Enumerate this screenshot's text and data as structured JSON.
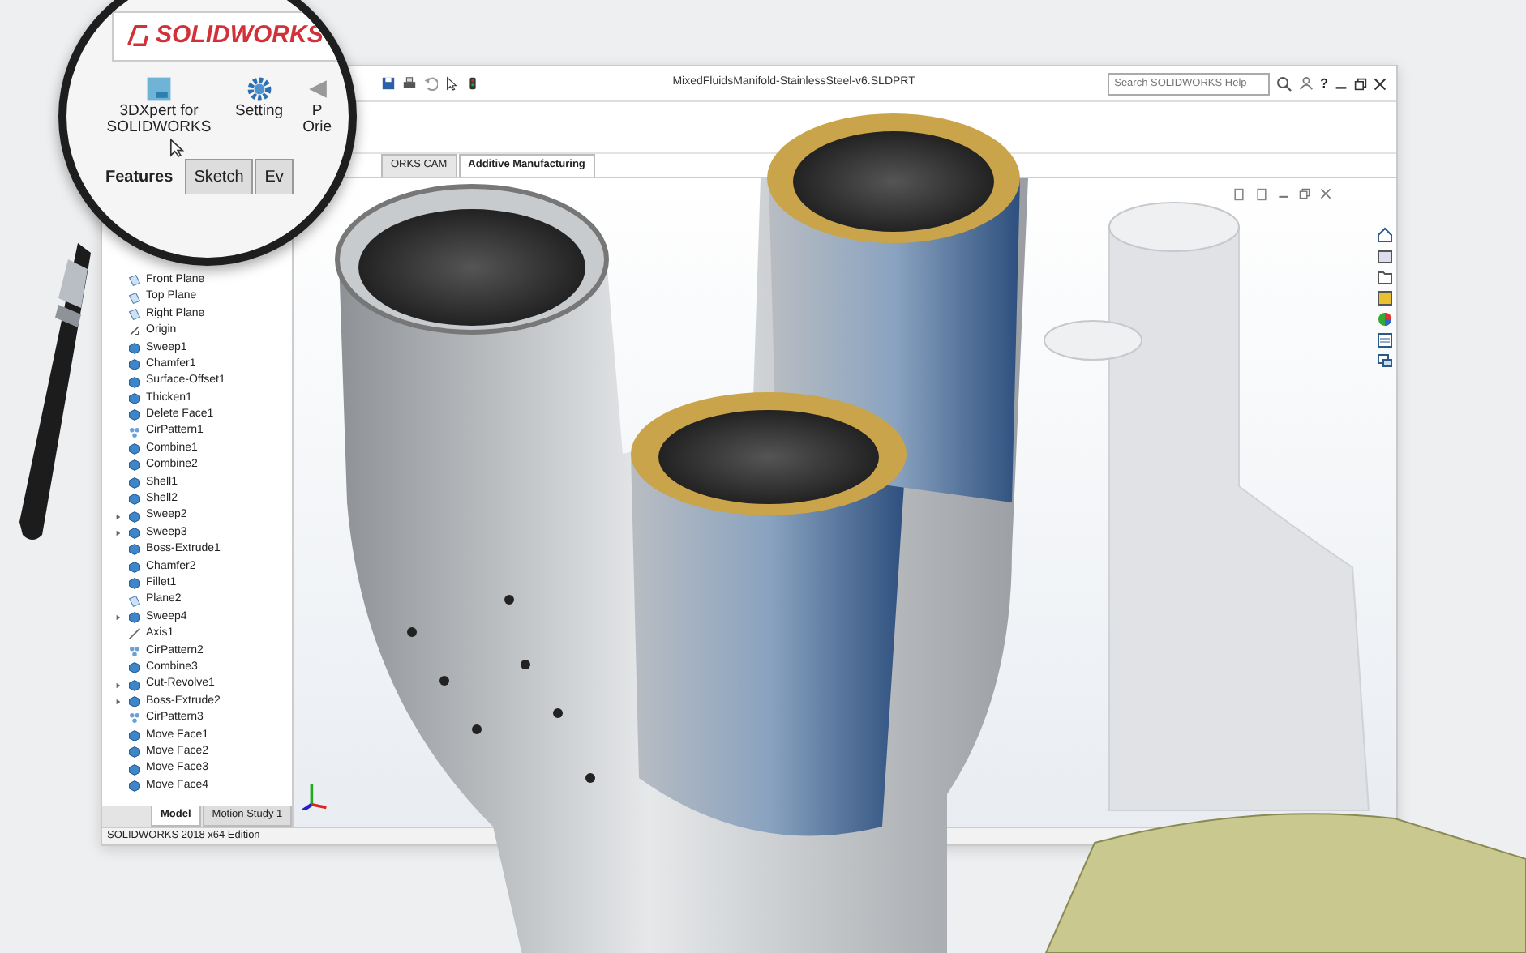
{
  "window": {
    "title": "MixedFluidsManifold-StainlessSteel-v6.SLDPRT",
    "help_label": "?"
  },
  "search": {
    "placeholder": "Search SOLIDWORKS Help"
  },
  "magnifier": {
    "logo": "SOLIDWORKS",
    "commands": [
      {
        "label": "3DXpert for SOLIDWORKS",
        "kind": "xpert"
      },
      {
        "label": "Setting",
        "kind": "gear"
      },
      {
        "label": "P Orie",
        "kind": "cut"
      }
    ],
    "tabs": [
      {
        "label": "Features",
        "selected": true
      },
      {
        "label": "Sketch",
        "selected": false
      },
      {
        "label": "Ev",
        "selected": false
      }
    ]
  },
  "command_tabs": [
    {
      "label": "ORKS CAM",
      "selected": false
    },
    {
      "label": "Additive Manufacturing",
      "selected": true
    }
  ],
  "feature_tree": {
    "items": [
      {
        "label": "Front Plane",
        "kind": "plane"
      },
      {
        "label": "Top Plane",
        "kind": "plane"
      },
      {
        "label": "Right Plane",
        "kind": "plane"
      },
      {
        "label": "Origin",
        "kind": "origin"
      },
      {
        "label": "Sweep1",
        "kind": "feature"
      },
      {
        "label": "Chamfer1",
        "kind": "feature"
      },
      {
        "label": "Surface-Offset1",
        "kind": "feature"
      },
      {
        "label": "Thicken1",
        "kind": "feature"
      },
      {
        "label": "Delete Face1",
        "kind": "feature"
      },
      {
        "label": "CirPattern1",
        "kind": "pattern"
      },
      {
        "label": "Combine1",
        "kind": "feature"
      },
      {
        "label": "Combine2",
        "kind": "feature"
      },
      {
        "label": "Shell1",
        "kind": "feature"
      },
      {
        "label": "Shell2",
        "kind": "feature"
      },
      {
        "label": "Sweep2",
        "kind": "folder"
      },
      {
        "label": "Sweep3",
        "kind": "folder"
      },
      {
        "label": "Boss-Extrude1",
        "kind": "feature"
      },
      {
        "label": "Chamfer2",
        "kind": "feature"
      },
      {
        "label": "Fillet1",
        "kind": "feature"
      },
      {
        "label": "Plane2",
        "kind": "plane"
      },
      {
        "label": "Sweep4",
        "kind": "folder"
      },
      {
        "label": "Axis1",
        "kind": "axis"
      },
      {
        "label": "CirPattern2",
        "kind": "pattern"
      },
      {
        "label": "Combine3",
        "kind": "feature"
      },
      {
        "label": "Cut-Revolve1",
        "kind": "folder"
      },
      {
        "label": "Boss-Extrude2",
        "kind": "folder"
      },
      {
        "label": "CirPattern3",
        "kind": "pattern"
      },
      {
        "label": "Move Face1",
        "kind": "feature"
      },
      {
        "label": "Move Face2",
        "kind": "feature"
      },
      {
        "label": "Move Face3",
        "kind": "feature"
      },
      {
        "label": "Move Face4",
        "kind": "feature"
      }
    ]
  },
  "bottom_tabs": [
    {
      "label": "Model",
      "selected": true
    },
    {
      "label": "Motion Study 1",
      "selected": false
    }
  ],
  "status_bar": "SOLIDWORKS 2018 x64 Edition"
}
